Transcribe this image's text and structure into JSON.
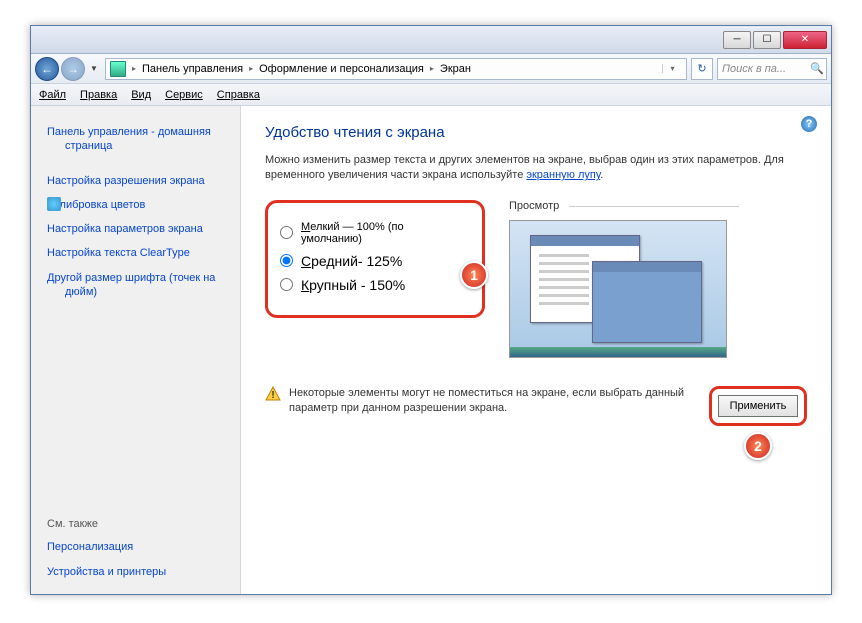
{
  "breadcrumb": {
    "l1": "Панель управления",
    "l2": "Оформление и персонализация",
    "l3": "Экран"
  },
  "search": {
    "placeholder": "Поиск в па..."
  },
  "menu": {
    "file": "Файл",
    "edit": "Правка",
    "view": "Вид",
    "service": "Сервис",
    "help": "Справка"
  },
  "sidebar": {
    "home": "Панель управления - домашняя страница",
    "resolution": "Настройка разрешения экрана",
    "calibrate": "Калибровка цветов",
    "params": "Настройка параметров экрана",
    "cleartype": "Настройка текста ClearType",
    "dpi": "Другой размер шрифта (точек на дюйм)",
    "seealso": "См. также",
    "personalize": "Персонализация",
    "devices": "Устройства и принтеры"
  },
  "main": {
    "heading": "Удобство чтения с экрана",
    "desc1": "Можно изменить размер текста и других элементов на экране, выбрав один из этих параметров. Для временного увеличения части экрана используйте ",
    "magnifier": "экранную лупу",
    "opt_small_prefix": "М",
    "opt_small_rest": "елкий — 100% (по умолчанию)",
    "opt_med_prefix": "С",
    "opt_med_rest": "редний- 125%",
    "opt_large_prefix": "К",
    "opt_large_rest": "рупный - 150%",
    "preview": "Просмотр",
    "warning": "Некоторые элементы могут не поместиться на экране, если выбрать данный параметр при данном разрешении экрана.",
    "apply": "Применить"
  },
  "badges": {
    "b1": "1",
    "b2": "2"
  }
}
